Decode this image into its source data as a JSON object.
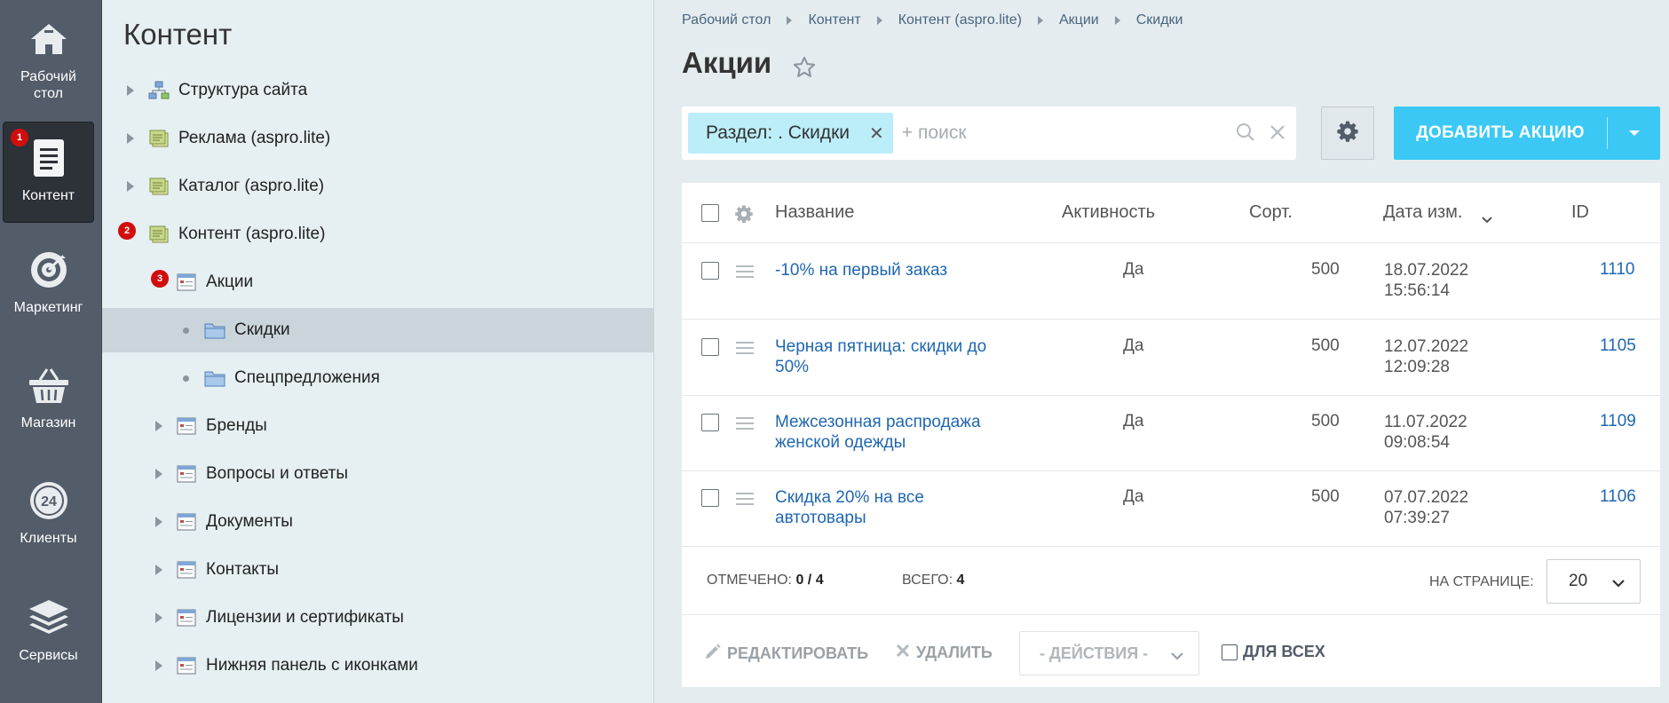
{
  "nav": {
    "items": [
      {
        "label": "Рабочий\nстол",
        "icon": "home-icon"
      },
      {
        "label": "Контент",
        "icon": "document-icon",
        "badge": "1",
        "active": true
      },
      {
        "label": "Маркетинг",
        "icon": "target-icon"
      },
      {
        "label": "Магазин",
        "icon": "basket-icon"
      },
      {
        "label": "Клиенты",
        "icon": "clock-24-icon"
      },
      {
        "label": "Сервисы",
        "icon": "layers-icon"
      }
    ]
  },
  "tree": {
    "title": "Контент",
    "items": [
      {
        "label": "Структура сайта",
        "icon": "site-structure-icon"
      },
      {
        "label": "Реклама (aspro.lite)",
        "icon": "iblock-type-icon"
      },
      {
        "label": "Каталог (aspro.lite)",
        "icon": "iblock-type-icon"
      },
      {
        "label": "Контент (aspro.lite)",
        "icon": "iblock-type-icon",
        "badge": "2"
      },
      {
        "label": "Акции",
        "icon": "iblock-icon",
        "badge": "3"
      },
      {
        "label": "Скидки",
        "icon": "folder-icon",
        "selected": true
      },
      {
        "label": "Спецпредложения",
        "icon": "folder-icon"
      },
      {
        "label": "Бренды",
        "icon": "iblock-icon"
      },
      {
        "label": "Вопросы и ответы",
        "icon": "iblock-icon"
      },
      {
        "label": "Документы",
        "icon": "iblock-icon"
      },
      {
        "label": "Контакты",
        "icon": "iblock-icon"
      },
      {
        "label": "Лицензии и сертификаты",
        "icon": "iblock-icon"
      },
      {
        "label": "Нижняя панель с иконками",
        "icon": "iblock-icon"
      }
    ]
  },
  "breadcrumb": [
    "Рабочий стол",
    "Контент",
    "Контент (aspro.lite)",
    "Акции",
    "Скидки"
  ],
  "page": {
    "title": "Акции"
  },
  "filter": {
    "chip": "Раздел: . Скидки",
    "plus": "+",
    "placeholder": "поиск"
  },
  "toolbar": {
    "add_label": "ДОБАВИТЬ АКЦИЮ"
  },
  "grid": {
    "columns": {
      "name": "Название",
      "active": "Активность",
      "sort": "Сорт.",
      "date": "Дата изм.",
      "id": "ID"
    },
    "rows": [
      {
        "name": "-10% на первый заказ",
        "active": "Да",
        "sort": "500",
        "date": "18.07.2022",
        "time": "15:56:14",
        "id": "1110"
      },
      {
        "name": "Черная пятница: скидки до 50%",
        "active": "Да",
        "sort": "500",
        "date": "12.07.2022",
        "time": "12:09:28",
        "id": "1105"
      },
      {
        "name": "Межсезонная распродажа женской одежды",
        "active": "Да",
        "sort": "500",
        "date": "11.07.2022",
        "time": "09:08:54",
        "id": "1109"
      },
      {
        "name": "Скидка 20% на все автотовары",
        "active": "Да",
        "sort": "500",
        "date": "07.07.2022",
        "time": "07:39:27",
        "id": "1106"
      }
    ],
    "footer": {
      "selected_label": "ОТМЕЧЕНО:",
      "selected_value": "0 / 4",
      "total_label": "ВСЕГО:",
      "total_value": "4",
      "per_page_label": "НА СТРАНИЦЕ:",
      "per_page_value": "20"
    },
    "actions": {
      "edit": "РЕДАКТИРОВАТЬ",
      "delete": "УДАЛИТЬ",
      "actions_dropdown": "- ДЕЙСТВИЯ -",
      "for_all": "ДЛЯ ВСЕХ"
    }
  }
}
